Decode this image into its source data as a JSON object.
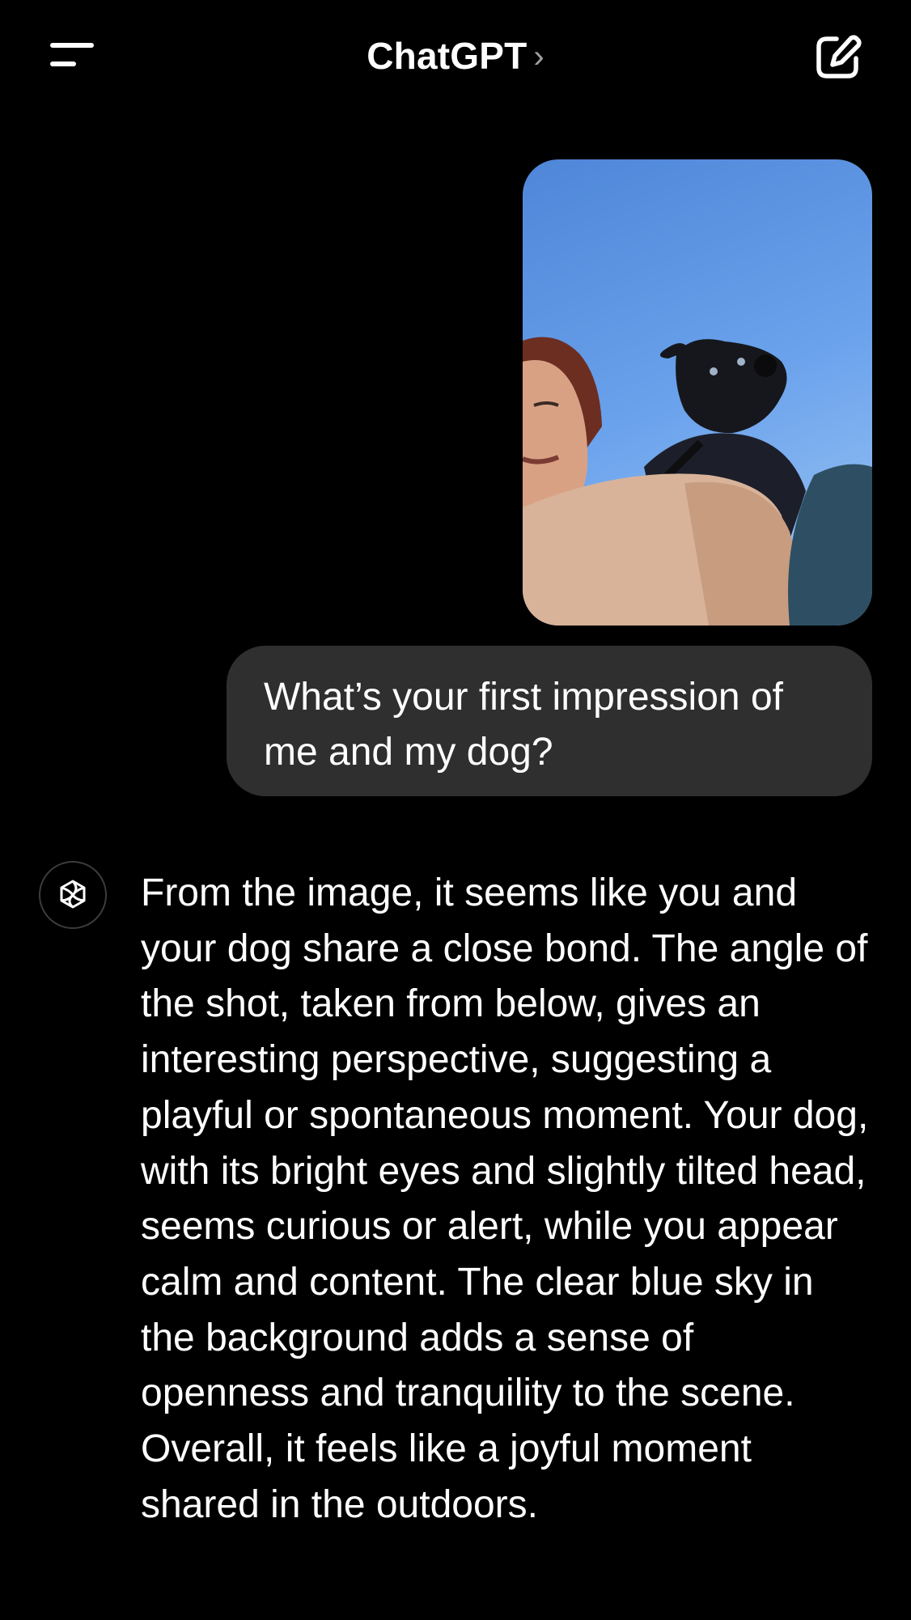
{
  "header": {
    "title": "ChatGPT",
    "chevron": "›",
    "menu_icon": "menu-icon",
    "compose_icon": "compose-icon"
  },
  "conversation": {
    "user_image": {
      "kind": "photo",
      "icon": "user-photo"
    },
    "user_message": "What’s your first impression of me and my dog?",
    "assistant_avatar_icon": "openai-logo-icon",
    "assistant_message": "From the image, it seems like you and your dog share a close bond. The angle of the shot, taken from below, gives an interesting perspective, suggesting a playful or spontaneous moment. Your dog, with its bright eyes and slightly tilted head, seems curious or alert, while you appear calm and content. The clear blue sky in the background adds a sense of openness and tranquility to the scene. Overall, it feels like a joyful moment shared in the outdoors."
  },
  "colors": {
    "background": "#000000",
    "user_bubble": "#2f2f2f",
    "text": "#ffffff",
    "sky": "#5d93e0"
  }
}
